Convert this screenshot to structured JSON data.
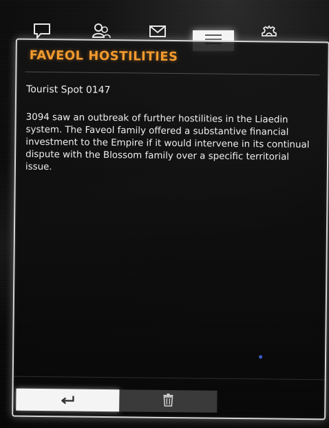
{
  "tabs": [
    {
      "id": "messages",
      "icon": "speech-bubble-icon",
      "active": false
    },
    {
      "id": "contacts",
      "icon": "people-icon",
      "active": false
    },
    {
      "id": "mail",
      "icon": "envelope-icon",
      "active": false
    },
    {
      "id": "log",
      "icon": "list-icon",
      "active": true
    },
    {
      "id": "settings",
      "icon": "gear-icon",
      "active": false
    }
  ],
  "panel": {
    "title": "FAVEOL HOSTILITIES",
    "subtitle": "Tourist Spot 0147",
    "body": "3094 saw an outbreak of further hostilities in the Liaedin system. The Faveol family offered a substantive financial investment to the Empire if it would intervene in its continual dispute with the Blossom family over a specific territorial issue."
  },
  "actions": {
    "back_icon": "back-arrow-icon",
    "delete_icon": "trash-icon"
  },
  "colors": {
    "title": "#f29a2e",
    "active_tab": "#f4f4f4",
    "panel_border": "#d8d8d8",
    "delete_button": "#3a3a3a"
  }
}
